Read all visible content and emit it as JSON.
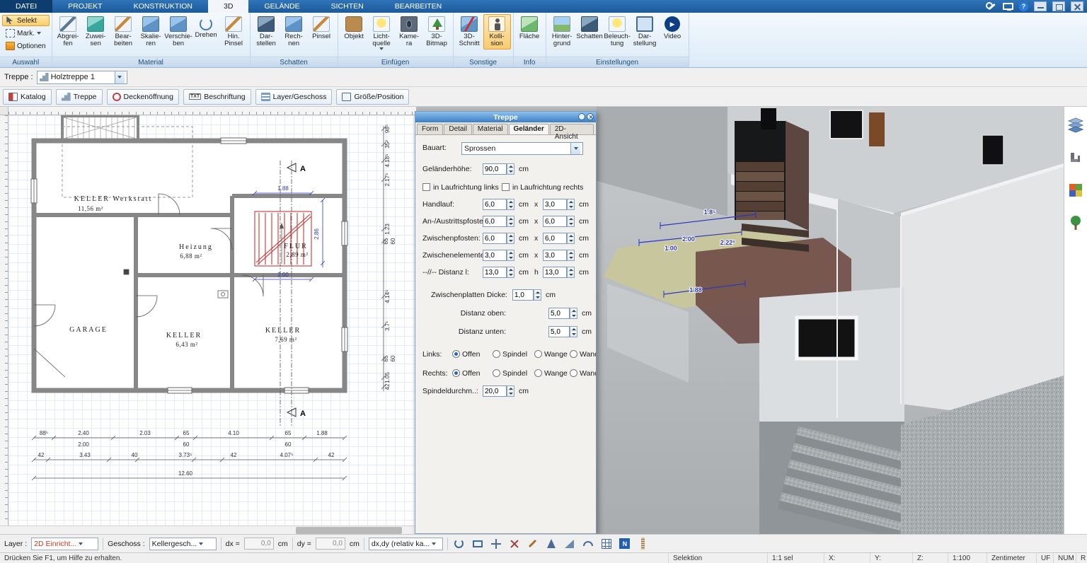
{
  "titlebar": {
    "tabs": [
      "DATEI",
      "PROJEKT",
      "KONSTRUKTION",
      "3D",
      "GELÄNDE",
      "SICHTEN",
      "BEARBEITEN"
    ],
    "help_glyph": "?"
  },
  "ribbon": {
    "auswahl": {
      "caption": "Auswahl",
      "selekt": "Selekt",
      "mark": "Mark.",
      "optionen": "Optionen"
    },
    "material": {
      "caption": "Material",
      "b": [
        "Abgrei-\nfen",
        "Zuwei-\nsen",
        "Bear-\nbeiten",
        "Skalie-\nren",
        "Verschie-\nben",
        "Drehen",
        "Hin.\nPinsel"
      ]
    },
    "schatten": {
      "caption": "Schatten",
      "b": [
        "Dar-\nstellen",
        "Rech-\nnen",
        "Pinsel"
      ]
    },
    "einfuegen": {
      "caption": "Einfügen",
      "b": [
        "Objekt",
        "Licht-\nquelle",
        "Kame-\nra",
        "3D-\nBitmap"
      ]
    },
    "sonstige": {
      "caption": "Sonstige",
      "b": [
        "3D-\nSchnitt",
        "Kolli-\nsion"
      ]
    },
    "info": {
      "caption": "Info",
      "b": [
        "Fläche"
      ]
    },
    "einstellungen": {
      "caption": "Einstellungen",
      "b": [
        "Hinter-\ngrund",
        "Schatten",
        "Beleuch-\ntung",
        "Dar-\nstellung",
        "Video"
      ]
    },
    "play_glyph": "▶"
  },
  "toolbar2": {
    "treppe_label": "Treppe :",
    "treppe_value": "Holztreppe 1",
    "katalog": "Katalog",
    "treppe": "Treppe",
    "deckenoeffnung": "Deckenöffnung",
    "txt_glyph": "TXT",
    "beschriftung": "Beschriftung",
    "layer_geschoss": "Layer/Geschoss",
    "groesse_position": "Größe/Position"
  },
  "dialog": {
    "title": "Treppe",
    "tabs": [
      "Form",
      "Detail",
      "Material",
      "Geländer",
      "2D-Ansicht"
    ],
    "bauart_label": "Bauart:",
    "bauart_value": "Sprossen",
    "gel_label": "Geländerhöhe:",
    "gel_value": "90,0",
    "cm": "cm",
    "chk_links": "in Laufrichtung links",
    "chk_rechts": "in Laufrichtung rechts",
    "rows": [
      {
        "label": "Handlauf:",
        "v1": "6,0",
        "sep": "x",
        "v2": "3,0"
      },
      {
        "label": "An-/Austrittspfosten:",
        "v1": "6,0",
        "sep": "x",
        "v2": "6,0"
      },
      {
        "label": "Zwischenpfosten:",
        "v1": "6,0",
        "sep": "x",
        "v2": "6,0"
      },
      {
        "label": "Zwischenelemente:",
        "v1": "3,0",
        "sep": "x",
        "v2": "3,0"
      },
      {
        "label": "--//-- Distanz l:",
        "v1": "13,0",
        "sep": "h",
        "v2": "13,0"
      }
    ],
    "zp_label": "Zwischenplatten Dicke:",
    "zp_value": "1,0",
    "do_label": "Distanz oben:",
    "do_value": "5,0",
    "du_label": "Distanz unten:",
    "du_value": "5,0",
    "links_label": "Links:",
    "rechts_label": "Rechts:",
    "radios": [
      "Offen",
      "Spindel",
      "Wange",
      "Wand"
    ],
    "spindel_label": "Spindeldurchm..:",
    "spindel_value": "20,0"
  },
  "plan": {
    "rooms": [
      {
        "name": "KELLER Werkstatt",
        "area": "11,56 m²"
      },
      {
        "name": "Heizung",
        "area": "6,88 m²"
      },
      {
        "name": "GARAGE",
        "area": ""
      },
      {
        "name": "KELLER",
        "area": "6,43 m²"
      },
      {
        "name": "KELLER",
        "area": "7,69 m²"
      },
      {
        "name": "FLUR",
        "area": "2,89 m²"
      }
    ],
    "stair_dim_top": "1.88",
    "stair_dim_bottom": "2.00",
    "stair_dim_right": "2.86",
    "section_marker": "A",
    "dims_bottom_row1": [
      "88⁵",
      "2.40",
      "2.03",
      "65",
      "4.10",
      "65",
      "1.88"
    ],
    "dims_bottom_row1b": [
      "2.00",
      "60",
      "60"
    ],
    "dims_bottom_row2": [
      "42",
      "3.43",
      "40",
      "3.73⁵",
      "42",
      "4.07⁵",
      "42"
    ],
    "dims_bottom_total": "12.60",
    "dims_right": [
      "98⁵",
      "35²",
      "4.18⁵",
      "2.17⁵",
      "1.23",
      "65",
      "60",
      "4.14⁵",
      "3.7¹",
      "65",
      "60",
      "1.05",
      "42"
    ]
  },
  "view3d": {
    "dims": [
      "1.8⁵",
      "2.00",
      "1.00",
      "2.22³",
      "1.88"
    ]
  },
  "bottombar": {
    "layer_label": "Layer :",
    "layer_value": "2D Einricht...",
    "geschoss_label": "Geschoss :",
    "geschoss_value": "Kellergesch...",
    "dx_label": "dx =",
    "dx_value": "0,0",
    "dy_label": "dy =",
    "dy_value": "0,0",
    "cm": "cm",
    "mode_value": "dx,dy (relativ ka...",
    "north_glyph": "N"
  },
  "statusbar": {
    "help": "Drücken Sie F1, um Hilfe zu erhalten.",
    "selektion": "Selektion",
    "sel_ratio": "1:1 sel",
    "x_label": "X:",
    "y_label": "Y:",
    "z_label": "Z:",
    "scale": "1:100",
    "unit": "Zentimeter",
    "uf": "UF",
    "num": "NUM",
    "r": "R"
  },
  "colors": {
    "accent_blue": "#2a6cb5",
    "highlight_orange": "#f5a623",
    "dim_blue": "#2a35c0",
    "stair_red": "#c93434"
  }
}
